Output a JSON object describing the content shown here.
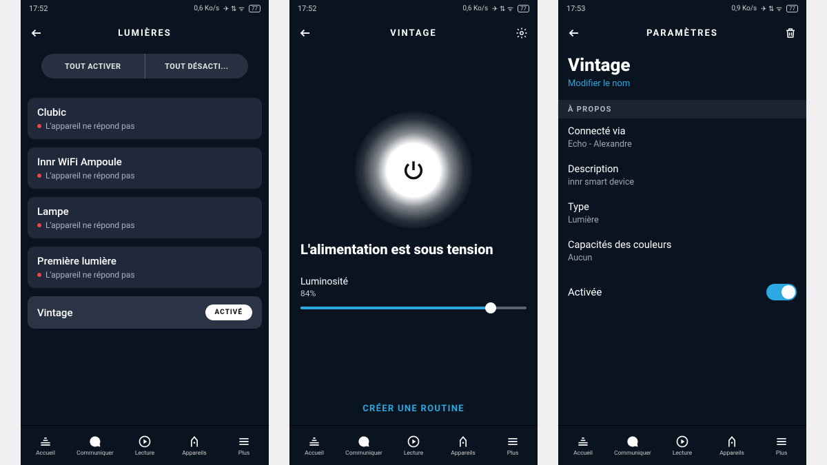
{
  "screens": [
    {
      "status": {
        "time": "17:52",
        "rate": "0,6 Ko/s"
      },
      "title": "LUMIÈRES",
      "segment": {
        "on": "TOUT ACTIVER",
        "off": "TOUT DÉSACTI..."
      },
      "devices": [
        {
          "name": "Clubic",
          "status": "L'appareil ne répond pas",
          "offline": true
        },
        {
          "name": "Innr WiFi Ampoule",
          "status": "L'appareil ne répond pas",
          "offline": true
        },
        {
          "name": "Lampe",
          "status": "L'appareil ne répond pas",
          "offline": true
        },
        {
          "name": "Première lumière",
          "status": "L'appareil ne répond pas",
          "offline": true
        },
        {
          "name": "Vintage",
          "badge": "ACTIVÉ",
          "offline": false
        }
      ]
    },
    {
      "status": {
        "time": "17:52",
        "rate": "0,6 Ko/s"
      },
      "title": "VINTAGE",
      "power_label": "L'alimentation est sous tension",
      "brightness": {
        "label": "Luminosité",
        "value": "84%",
        "percent": 84
      },
      "routine": "CRÉER UNE ROUTINE"
    },
    {
      "status": {
        "time": "17:53",
        "rate": "0,9 Ko/s"
      },
      "title": "PARAMÈTRES",
      "name": "Vintage",
      "edit_link": "Modifier le nom",
      "about_hd": "À PROPOS",
      "rows": [
        {
          "label": "Connecté via",
          "value": "Echo  - Alexandre"
        },
        {
          "label": "Description",
          "value": "innr smart device"
        },
        {
          "label": "Type",
          "value": "Lumière"
        },
        {
          "label": "Capacités des couleurs",
          "value": "Aucun"
        }
      ],
      "enabled_label": "Activée",
      "enabled": true
    }
  ],
  "nav": [
    {
      "label": "Accueil"
    },
    {
      "label": "Communiquer"
    },
    {
      "label": "Lecture"
    },
    {
      "label": "Appareils"
    },
    {
      "label": "Plus"
    }
  ],
  "battery": "77"
}
